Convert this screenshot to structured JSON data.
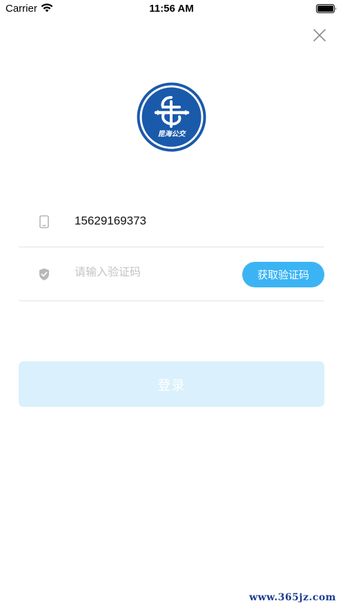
{
  "status_bar": {
    "carrier": "Carrier",
    "time": "11:56 AM"
  },
  "logo": {
    "text": "昆海公交",
    "color": "#1a5aab"
  },
  "form": {
    "phone_icon": "mobile-phone-icon",
    "phone_value": "15629169373",
    "shield_icon": "shield-check-icon",
    "code_placeholder": "请输入验证码",
    "get_code_label": "获取验证码",
    "accent": "#3cb4f4"
  },
  "login_label": "登录",
  "watermark": "www.365jz.com"
}
